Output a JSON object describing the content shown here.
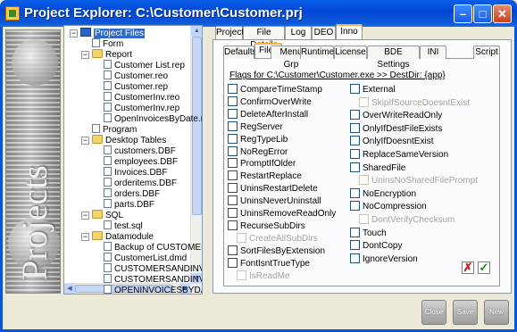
{
  "window": {
    "title": "Project Explorer: C:\\Customer\\Customer.prj"
  },
  "banner": {
    "text": "Projects"
  },
  "tree": [
    {
      "label": "Project Files",
      "icon": "project-root-icon",
      "selected": true
    },
    {
      "label": "Form",
      "icon": "file-icon"
    },
    {
      "label": "Report",
      "icon": "folder-icon"
    },
    {
      "label": "Customer List.rep",
      "icon": "file-icon"
    },
    {
      "label": "Customer.reo",
      "icon": "file-icon"
    },
    {
      "label": "Customer.rep",
      "icon": "file-icon"
    },
    {
      "label": "CustomerInv.reo",
      "icon": "file-icon"
    },
    {
      "label": "CustomerInv.rep",
      "icon": "file-icon"
    },
    {
      "label": "OpenInvoicesByDate.rep",
      "icon": "file-icon"
    },
    {
      "label": "Program",
      "icon": "file-icon"
    },
    {
      "label": "Desktop Tables",
      "icon": "folder-icon"
    },
    {
      "label": "customers.DBF",
      "icon": "file-icon"
    },
    {
      "label": "employees.DBF",
      "icon": "file-icon"
    },
    {
      "label": "Invoices.DBF",
      "icon": "file-icon"
    },
    {
      "label": "orderitems.DBF",
      "icon": "file-icon"
    },
    {
      "label": "orders.DBF",
      "icon": "file-icon"
    },
    {
      "label": "parts.DBF",
      "icon": "file-icon"
    },
    {
      "label": "SQL",
      "icon": "folder-icon"
    },
    {
      "label": "test.sql",
      "icon": "file-icon"
    },
    {
      "label": "Datamodule",
      "icon": "folder-icon"
    },
    {
      "label": "Backup of CUSTOMERS",
      "icon": "file-icon"
    },
    {
      "label": "CustomerList.dmd",
      "icon": "file-icon"
    },
    {
      "label": "CUSTOMERSANDINVOI",
      "icon": "file-icon"
    },
    {
      "label": "CUSTOMERSANDINVOI",
      "icon": "file-icon"
    },
    {
      "label": "OPENINVOICESBYDATE",
      "icon": "file-icon"
    }
  ],
  "outer_tabs": [
    "Project",
    "File Details",
    "Log",
    "DEO",
    "Inno"
  ],
  "outer_active": "Inno",
  "inner_tabs": [
    "Defaults",
    "Files",
    "Menu Grp",
    "Runtime",
    "License",
    "BDE Settings",
    "INI",
    "Script"
  ],
  "inner_active": "Files",
  "flags_title": "Flags for C:\\Customer\\Customer.exe >> DestDir: {app}",
  "flags_left": [
    {
      "label": "CompareTimeStamp",
      "disabled": false
    },
    {
      "label": "ConfirmOverWrite",
      "disabled": false
    },
    {
      "label": "DeleteAfterInstall",
      "disabled": false
    },
    {
      "label": "RegServer",
      "disabled": false
    },
    {
      "label": "RegTypeLib",
      "disabled": false
    },
    {
      "label": "NoRegError",
      "disabled": false
    },
    {
      "label": "PromptIfOlder",
      "disabled": false
    },
    {
      "label": "RestartReplace",
      "disabled": false
    },
    {
      "label": "UninsRestartDelete",
      "disabled": false
    },
    {
      "label": "UninsNeverUninstall",
      "disabled": false
    },
    {
      "label": "UninsRemoveReadOnly",
      "disabled": false
    },
    {
      "label": "RecurseSubDirs",
      "disabled": false
    },
    {
      "label": "CreateAllSubDirs",
      "disabled": true
    },
    {
      "label": "SortFilesByExtension",
      "disabled": false
    },
    {
      "label": "FontIsntTrueType",
      "disabled": false
    },
    {
      "label": "IsReadMe",
      "disabled": true
    }
  ],
  "flags_right": [
    {
      "label": "External",
      "disabled": false
    },
    {
      "label": "SkipIfSourceDoesntExist",
      "disabled": true
    },
    {
      "label": "OverWriteReadOnly",
      "disabled": false
    },
    {
      "label": "OnlyIfDestFileExists",
      "disabled": false
    },
    {
      "label": "OnlyIfDoesntExist",
      "disabled": false
    },
    {
      "label": "ReplaceSameVersion",
      "disabled": false
    },
    {
      "label": "SharedFile",
      "disabled": false
    },
    {
      "label": "UninsNoSharedFilePrompt",
      "disabled": true
    },
    {
      "label": "NoEncryption",
      "disabled": false
    },
    {
      "label": "NoCompression",
      "disabled": false
    },
    {
      "label": "DontVerifyChecksum",
      "disabled": true
    },
    {
      "label": "Touch",
      "disabled": false
    },
    {
      "label": "DontCopy",
      "disabled": false
    },
    {
      "label": "IgnoreVersion",
      "disabled": false
    }
  ],
  "buttons": {
    "close": "Close",
    "save": "Save",
    "new": "New"
  }
}
